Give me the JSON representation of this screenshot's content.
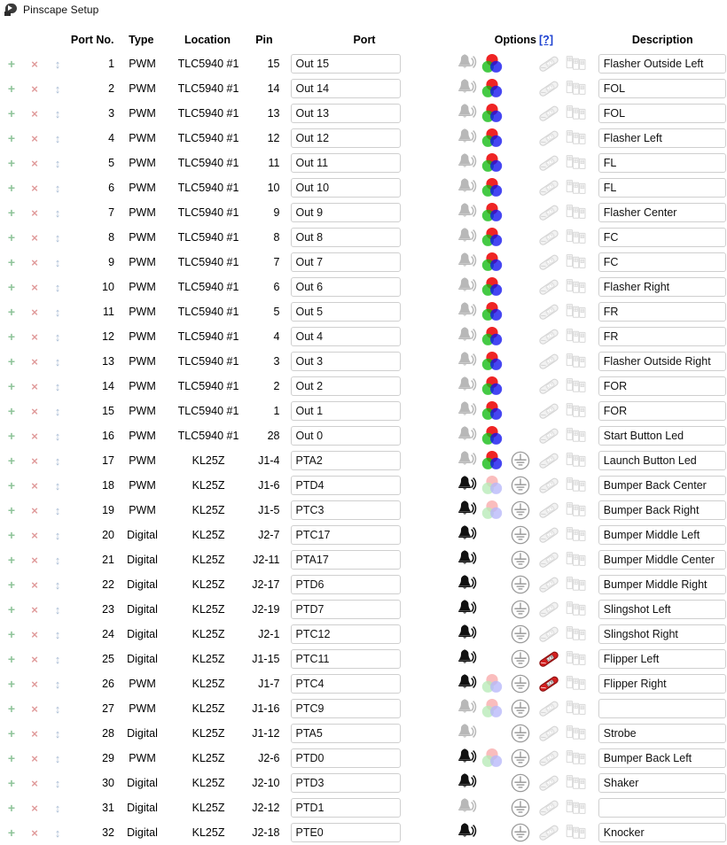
{
  "window": {
    "title": "Pinscape Setup",
    "icon": "pinscape-app-icon"
  },
  "table": {
    "headers": {
      "actions": "",
      "port_no": "Port No.",
      "type": "Type",
      "location": "Location",
      "pin": "Pin",
      "port": "Port",
      "options": "Options",
      "options_help": "[?]",
      "description": "Description"
    },
    "row_icons": {
      "add": "+",
      "delete": "×",
      "move": "↕"
    },
    "option_icon_names": [
      "bell-icon",
      "rgb-icon",
      "ground-icon",
      "flipper-logic-icon",
      "chime-board-icon"
    ],
    "rows": [
      {
        "num": "1",
        "type": "PWM",
        "location": "TLC5940 #1",
        "pin": "15",
        "port": "Out 15",
        "desc": "Flasher Outside Left",
        "opts": {
          "bell": "off",
          "rgb": "on",
          "ground": "none",
          "flipper": "off",
          "chime": "off"
        }
      },
      {
        "num": "2",
        "type": "PWM",
        "location": "TLC5940 #1",
        "pin": "14",
        "port": "Out 14",
        "desc": "FOL",
        "opts": {
          "bell": "off",
          "rgb": "on",
          "ground": "none",
          "flipper": "off",
          "chime": "off"
        }
      },
      {
        "num": "3",
        "type": "PWM",
        "location": "TLC5940 #1",
        "pin": "13",
        "port": "Out 13",
        "desc": "FOL",
        "opts": {
          "bell": "off",
          "rgb": "on",
          "ground": "none",
          "flipper": "off",
          "chime": "off"
        }
      },
      {
        "num": "4",
        "type": "PWM",
        "location": "TLC5940 #1",
        "pin": "12",
        "port": "Out 12",
        "desc": "Flasher Left",
        "opts": {
          "bell": "off",
          "rgb": "on",
          "ground": "none",
          "flipper": "off",
          "chime": "off"
        }
      },
      {
        "num": "5",
        "type": "PWM",
        "location": "TLC5940 #1",
        "pin": "11",
        "port": "Out 11",
        "desc": "FL",
        "opts": {
          "bell": "off",
          "rgb": "on",
          "ground": "none",
          "flipper": "off",
          "chime": "off"
        }
      },
      {
        "num": "6",
        "type": "PWM",
        "location": "TLC5940 #1",
        "pin": "10",
        "port": "Out 10",
        "desc": "FL",
        "opts": {
          "bell": "off",
          "rgb": "on",
          "ground": "none",
          "flipper": "off",
          "chime": "off"
        }
      },
      {
        "num": "7",
        "type": "PWM",
        "location": "TLC5940 #1",
        "pin": "9",
        "port": "Out 9",
        "desc": "Flasher Center",
        "opts": {
          "bell": "off",
          "rgb": "on",
          "ground": "none",
          "flipper": "off",
          "chime": "off"
        }
      },
      {
        "num": "8",
        "type": "PWM",
        "location": "TLC5940 #1",
        "pin": "8",
        "port": "Out 8",
        "desc": "FC",
        "opts": {
          "bell": "off",
          "rgb": "on",
          "ground": "none",
          "flipper": "off",
          "chime": "off"
        }
      },
      {
        "num": "9",
        "type": "PWM",
        "location": "TLC5940 #1",
        "pin": "7",
        "port": "Out 7",
        "desc": "FC",
        "opts": {
          "bell": "off",
          "rgb": "on",
          "ground": "none",
          "flipper": "off",
          "chime": "off"
        }
      },
      {
        "num": "10",
        "type": "PWM",
        "location": "TLC5940 #1",
        "pin": "6",
        "port": "Out 6",
        "desc": "Flasher Right",
        "opts": {
          "bell": "off",
          "rgb": "on",
          "ground": "none",
          "flipper": "off",
          "chime": "off"
        }
      },
      {
        "num": "11",
        "type": "PWM",
        "location": "TLC5940 #1",
        "pin": "5",
        "port": "Out 5",
        "desc": "FR",
        "opts": {
          "bell": "off",
          "rgb": "on",
          "ground": "none",
          "flipper": "off",
          "chime": "off"
        }
      },
      {
        "num": "12",
        "type": "PWM",
        "location": "TLC5940 #1",
        "pin": "4",
        "port": "Out 4",
        "desc": "FR",
        "opts": {
          "bell": "off",
          "rgb": "on",
          "ground": "none",
          "flipper": "off",
          "chime": "off"
        }
      },
      {
        "num": "13",
        "type": "PWM",
        "location": "TLC5940 #1",
        "pin": "3",
        "port": "Out 3",
        "desc": "Flasher Outside Right",
        "opts": {
          "bell": "off",
          "rgb": "on",
          "ground": "none",
          "flipper": "off",
          "chime": "off"
        }
      },
      {
        "num": "14",
        "type": "PWM",
        "location": "TLC5940 #1",
        "pin": "2",
        "port": "Out 2",
        "desc": "FOR",
        "opts": {
          "bell": "off",
          "rgb": "on",
          "ground": "none",
          "flipper": "off",
          "chime": "off"
        }
      },
      {
        "num": "15",
        "type": "PWM",
        "location": "TLC5940 #1",
        "pin": "1",
        "port": "Out 1",
        "desc": "FOR",
        "opts": {
          "bell": "off",
          "rgb": "on",
          "ground": "none",
          "flipper": "off",
          "chime": "off"
        }
      },
      {
        "num": "16",
        "type": "PWM",
        "location": "TLC5940 #1",
        "pin": "28",
        "port": "Out 0",
        "desc": "Start Button Led",
        "opts": {
          "bell": "off",
          "rgb": "on",
          "ground": "none",
          "flipper": "off",
          "chime": "off"
        }
      },
      {
        "num": "17",
        "type": "PWM",
        "location": "KL25Z",
        "pin": "J1-4",
        "port": "PTA2",
        "desc": "Launch Button Led",
        "opts": {
          "bell": "off",
          "rgb": "on",
          "ground": "off",
          "flipper": "off",
          "chime": "off"
        }
      },
      {
        "num": "18",
        "type": "PWM",
        "location": "KL25Z",
        "pin": "J1-6",
        "port": "PTD4",
        "desc": "Bumper Back Center",
        "opts": {
          "bell": "on",
          "rgb": "dim",
          "ground": "off",
          "flipper": "off",
          "chime": "off"
        }
      },
      {
        "num": "19",
        "type": "PWM",
        "location": "KL25Z",
        "pin": "J1-5",
        "port": "PTC3",
        "desc": "Bumper Back Right",
        "opts": {
          "bell": "on",
          "rgb": "dim",
          "ground": "off",
          "flipper": "off",
          "chime": "off"
        }
      },
      {
        "num": "20",
        "type": "Digital",
        "location": "KL25Z",
        "pin": "J2-7",
        "port": "PTC17",
        "desc": "Bumper Middle Left",
        "opts": {
          "bell": "on",
          "rgb": "none",
          "ground": "off",
          "flipper": "off",
          "chime": "off"
        }
      },
      {
        "num": "21",
        "type": "Digital",
        "location": "KL25Z",
        "pin": "J2-11",
        "port": "PTA17",
        "desc": "Bumper Middle Center",
        "opts": {
          "bell": "on",
          "rgb": "none",
          "ground": "off",
          "flipper": "off",
          "chime": "off"
        }
      },
      {
        "num": "22",
        "type": "Digital",
        "location": "KL25Z",
        "pin": "J2-17",
        "port": "PTD6",
        "desc": "Bumper Middle Right",
        "opts": {
          "bell": "on",
          "rgb": "none",
          "ground": "off",
          "flipper": "off",
          "chime": "off"
        }
      },
      {
        "num": "23",
        "type": "Digital",
        "location": "KL25Z",
        "pin": "J2-19",
        "port": "PTD7",
        "desc": "Slingshot Left",
        "opts": {
          "bell": "on",
          "rgb": "none",
          "ground": "off",
          "flipper": "off",
          "chime": "off"
        }
      },
      {
        "num": "24",
        "type": "Digital",
        "location": "KL25Z",
        "pin": "J2-1",
        "port": "PTC12",
        "desc": "Slingshot Right",
        "opts": {
          "bell": "on",
          "rgb": "none",
          "ground": "off",
          "flipper": "off",
          "chime": "off"
        }
      },
      {
        "num": "25",
        "type": "Digital",
        "location": "KL25Z",
        "pin": "J1-15",
        "port": "PTC11",
        "desc": "Flipper Left",
        "opts": {
          "bell": "on",
          "rgb": "none",
          "ground": "off",
          "flipper": "on",
          "chime": "off"
        }
      },
      {
        "num": "26",
        "type": "PWM",
        "location": "KL25Z",
        "pin": "J1-7",
        "port": "PTC4",
        "desc": "Flipper Right",
        "opts": {
          "bell": "on",
          "rgb": "dim",
          "ground": "off",
          "flipper": "on",
          "chime": "off"
        }
      },
      {
        "num": "27",
        "type": "PWM",
        "location": "KL25Z",
        "pin": "J1-16",
        "port": "PTC9",
        "desc": "",
        "opts": {
          "bell": "off",
          "rgb": "dim",
          "ground": "off",
          "flipper": "off",
          "chime": "off"
        }
      },
      {
        "num": "28",
        "type": "Digital",
        "location": "KL25Z",
        "pin": "J1-12",
        "port": "PTA5",
        "desc": "Strobe",
        "opts": {
          "bell": "off",
          "rgb": "none",
          "ground": "off",
          "flipper": "off",
          "chime": "off"
        }
      },
      {
        "num": "29",
        "type": "PWM",
        "location": "KL25Z",
        "pin": "J2-6",
        "port": "PTD0",
        "desc": "Bumper Back Left",
        "opts": {
          "bell": "on",
          "rgb": "dim",
          "ground": "off",
          "flipper": "off",
          "chime": "off"
        }
      },
      {
        "num": "30",
        "type": "Digital",
        "location": "KL25Z",
        "pin": "J2-10",
        "port": "PTD3",
        "desc": "Shaker",
        "opts": {
          "bell": "on",
          "rgb": "none",
          "ground": "off",
          "flipper": "off",
          "chime": "off"
        }
      },
      {
        "num": "31",
        "type": "Digital",
        "location": "KL25Z",
        "pin": "J2-12",
        "port": "PTD1",
        "desc": "",
        "opts": {
          "bell": "off",
          "rgb": "none",
          "ground": "off",
          "flipper": "off",
          "chime": "off"
        }
      },
      {
        "num": "32",
        "type": "Digital",
        "location": "KL25Z",
        "pin": "J2-18",
        "port": "PTE0",
        "desc": "Knocker",
        "opts": {
          "bell": "on",
          "rgb": "none",
          "ground": "off",
          "flipper": "off",
          "chime": "off"
        }
      }
    ]
  },
  "colors": {
    "add": "#8fc49a",
    "delete": "#e09b9b",
    "move": "#a8bbd4",
    "link": "#1a3fd0",
    "rgb_red": "#ee1111",
    "rgb_green": "#11bb11",
    "rgb_blue": "#1111ee",
    "flipper_active": "#cc2222",
    "border": "#cfcfcf"
  }
}
